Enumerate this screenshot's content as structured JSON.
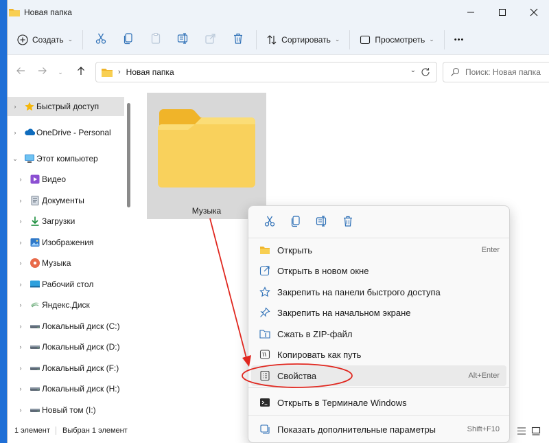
{
  "window": {
    "title": "Новая папка"
  },
  "toolbar": {
    "new_label": "Создать",
    "sort_label": "Сортировать",
    "view_label": "Просмотреть",
    "more_label": "•••"
  },
  "address": {
    "path": "Новая папка",
    "search_placeholder": "Поиск: Новая папка"
  },
  "sidebar": {
    "items": [
      {
        "label": "Быстрый доступ",
        "icon": "star-icon"
      },
      {
        "label": "OneDrive - Personal",
        "icon": "cloud-icon"
      },
      {
        "label": "Этот компьютер",
        "icon": "monitor-icon"
      },
      {
        "label": "Видео",
        "icon": "video-icon"
      },
      {
        "label": "Документы",
        "icon": "documents-icon"
      },
      {
        "label": "Загрузки",
        "icon": "download-icon"
      },
      {
        "label": "Изображения",
        "icon": "pictures-icon"
      },
      {
        "label": "Музыка",
        "icon": "music-icon"
      },
      {
        "label": "Рабочий стол",
        "icon": "desktop-icon"
      },
      {
        "label": "Яндекс.Диск",
        "icon": "yandex-disk-icon"
      },
      {
        "label": "Локальный диск (C:)",
        "icon": "drive-icon"
      },
      {
        "label": "Локальный диск (D:)",
        "icon": "drive-icon"
      },
      {
        "label": "Локальный диск (F:)",
        "icon": "drive-icon"
      },
      {
        "label": "Локальный диск (H:)",
        "icon": "drive-icon"
      },
      {
        "label": "Новый том (I:)",
        "icon": "drive-icon"
      }
    ]
  },
  "content": {
    "folder_name": "Музыка"
  },
  "status": {
    "count": "1 элемент",
    "selected": "Выбран 1 элемент"
  },
  "context_menu": {
    "items": [
      {
        "label": "Открыть",
        "shortcut": "Enter"
      },
      {
        "label": "Открыть в новом окне",
        "shortcut": ""
      },
      {
        "label": "Закрепить на панели быстрого доступа",
        "shortcut": ""
      },
      {
        "label": "Закрепить на начальном экране",
        "shortcut": ""
      },
      {
        "label": "Сжать в ZIP-файл",
        "shortcut": ""
      },
      {
        "label": "Копировать как путь",
        "shortcut": ""
      },
      {
        "label": "Свойства",
        "shortcut": "Alt+Enter"
      },
      {
        "label": "Открыть в Терминале Windows",
        "shortcut": ""
      },
      {
        "label": "Показать дополнительные параметры",
        "shortcut": "Shift+F10"
      }
    ]
  },
  "colors": {
    "accent": "#0067c0",
    "folder": "#f6c343",
    "annotation": "#e0271f"
  }
}
